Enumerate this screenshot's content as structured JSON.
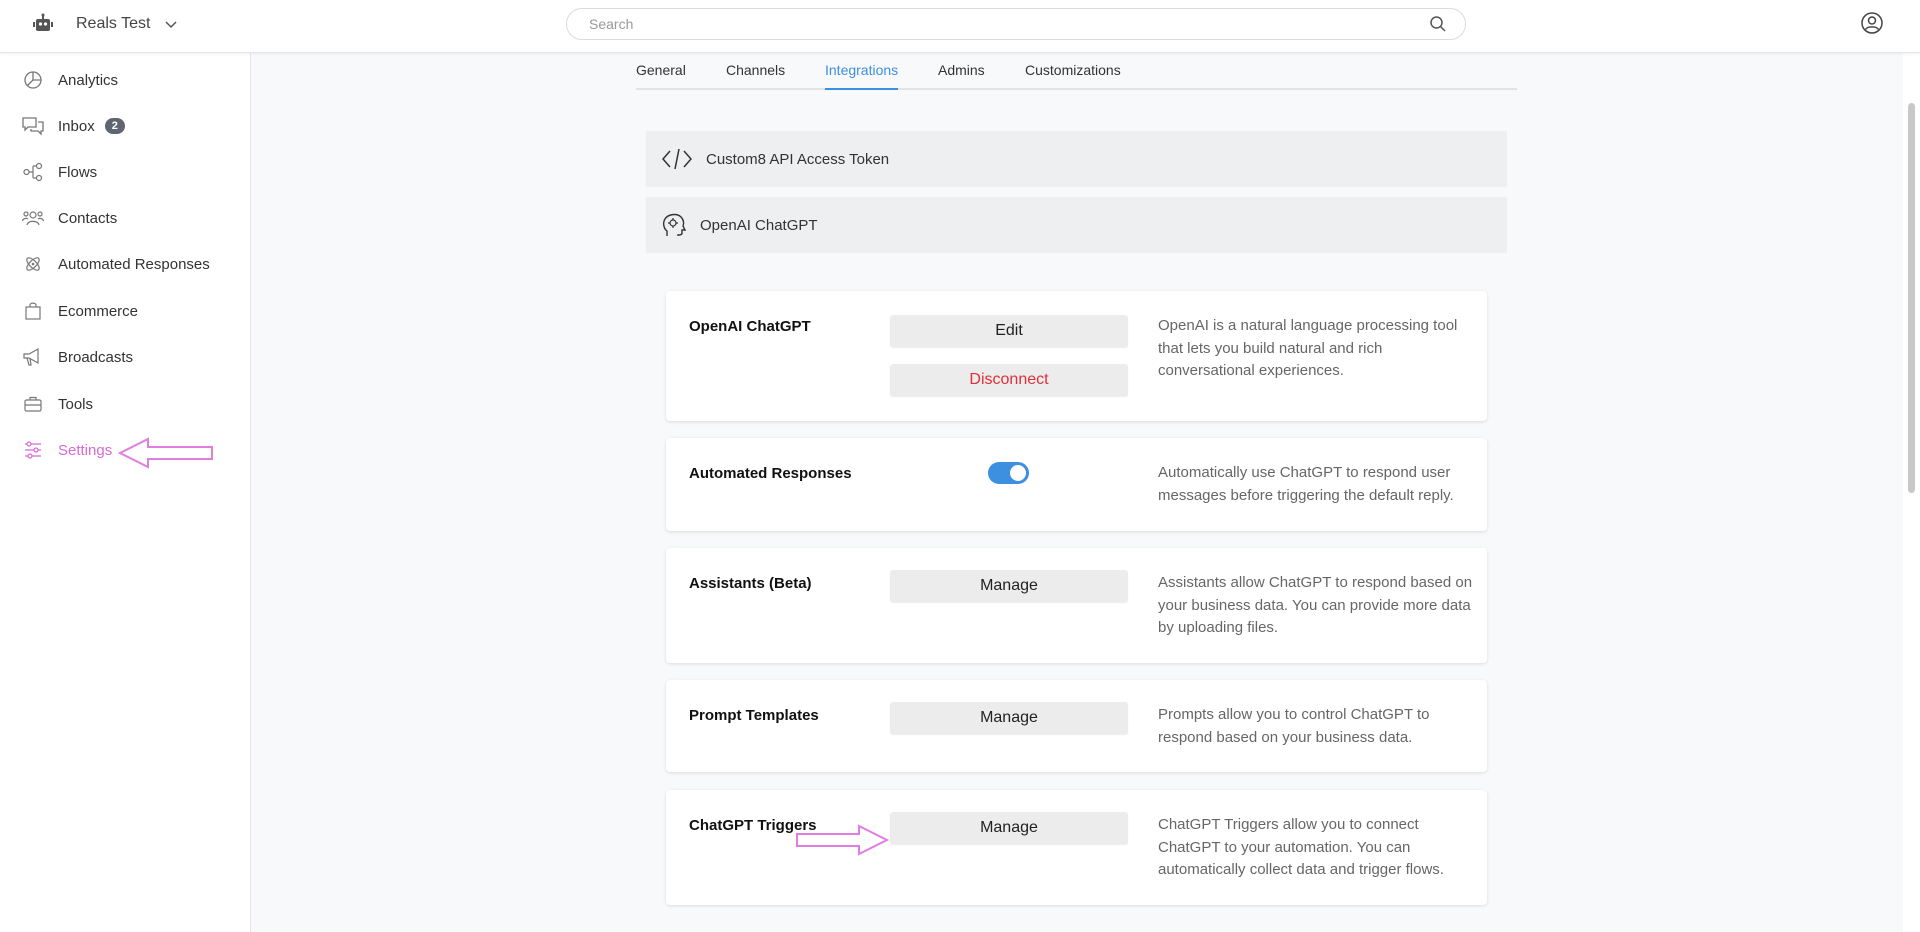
{
  "header": {
    "workspace_name": "Reals Test",
    "search_placeholder": "Search"
  },
  "sidebar": {
    "items": [
      {
        "label": "Analytics",
        "icon": "analytics-icon"
      },
      {
        "label": "Inbox",
        "icon": "inbox-icon",
        "badge": "2"
      },
      {
        "label": "Flows",
        "icon": "flows-icon"
      },
      {
        "label": "Contacts",
        "icon": "contacts-icon"
      },
      {
        "label": "Automated Responses",
        "icon": "automated-responses-icon"
      },
      {
        "label": "Ecommerce",
        "icon": "ecommerce-icon"
      },
      {
        "label": "Broadcasts",
        "icon": "broadcasts-icon"
      },
      {
        "label": "Tools",
        "icon": "tools-icon"
      },
      {
        "label": "Settings",
        "icon": "settings-icon",
        "active": true
      }
    ]
  },
  "tabs": [
    {
      "label": "General"
    },
    {
      "label": "Channels"
    },
    {
      "label": "Integrations",
      "active": true
    },
    {
      "label": "Admins"
    },
    {
      "label": "Customizations"
    }
  ],
  "sections": [
    {
      "label": "Custom8 API Access Token",
      "icon": "code-icon"
    },
    {
      "label": "OpenAI ChatGPT",
      "icon": "brain-head-icon"
    }
  ],
  "cards": [
    {
      "title": "OpenAI ChatGPT",
      "buttons": [
        "Edit",
        "Disconnect"
      ],
      "description": "OpenAI is a natural language processing tool that lets you build natural and rich conversational experiences."
    },
    {
      "title": "Automated Responses",
      "toggle_on": true,
      "description": "Automatically use ChatGPT to respond user messages before triggering the default reply."
    },
    {
      "title": "Assistants (Beta)",
      "buttons": [
        "Manage"
      ],
      "description": "Assistants allow ChatGPT to respond based on your business data. You can provide more data by uploading files."
    },
    {
      "title": "Prompt Templates",
      "buttons": [
        "Manage"
      ],
      "description": "Prompts allow you to control ChatGPT to respond based on your business data."
    },
    {
      "title": "ChatGPT Triggers",
      "buttons": [
        "Manage"
      ],
      "description": "ChatGPT Triggers allow you to connect ChatGPT to your automation. You can automatically collect data and trigger flows."
    }
  ],
  "colors": {
    "accent": "#3d8fe0",
    "active_nav": "#d86ad8",
    "danger": "#e0303a",
    "annotation_arrow": "#e07ee0"
  }
}
